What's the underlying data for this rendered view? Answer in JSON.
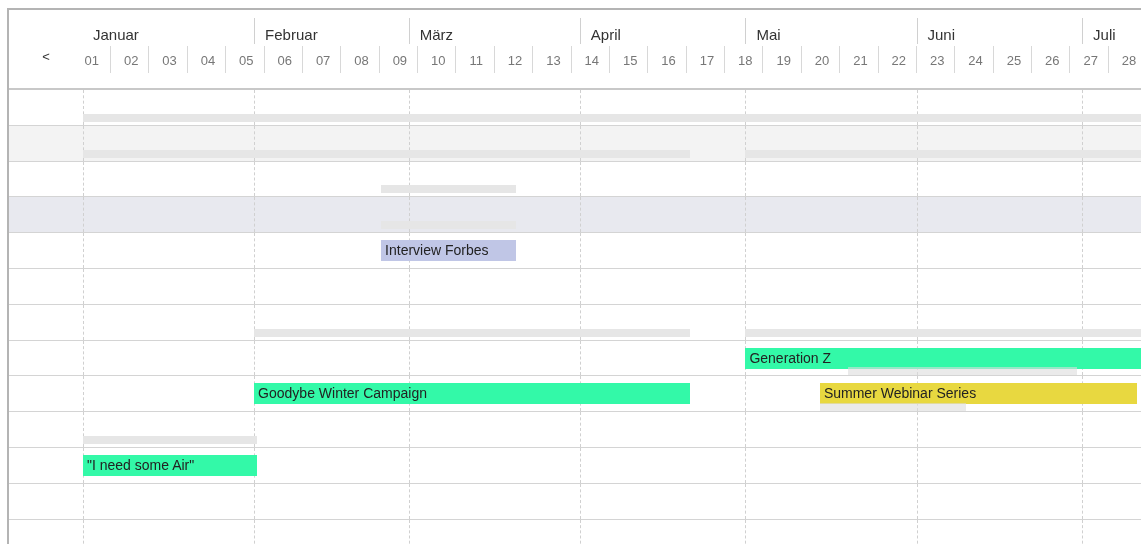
{
  "header": {
    "back_button": "<",
    "months": [
      "Januar",
      "Februar",
      "März",
      "April",
      "Mai",
      "Juni",
      "Juli"
    ],
    "weeks": [
      "01",
      "02",
      "03",
      "04",
      "05",
      "06",
      "07",
      "08",
      "09",
      "10",
      "11",
      "12",
      "13",
      "14",
      "15",
      "16",
      "17",
      "18",
      "19",
      "20",
      "21",
      "22",
      "23",
      "24",
      "25",
      "26",
      "27",
      "28"
    ]
  },
  "rows": [
    {
      "shaded": false,
      "selected": false,
      "items": [
        {
          "kind": "bracket"
        }
      ]
    },
    {
      "shaded": true,
      "selected": false,
      "items": [
        {
          "kind": "bracket"
        },
        {
          "kind": "bracket"
        }
      ]
    },
    {
      "shaded": false,
      "selected": false,
      "items": [
        {
          "kind": "bracket"
        }
      ]
    },
    {
      "shaded": false,
      "selected": true,
      "items": [
        {
          "kind": "bracket"
        }
      ]
    },
    {
      "shaded": false,
      "selected": false,
      "items": [
        {
          "kind": "bar",
          "label": "Interview Forbes",
          "color": "#c0c6e6"
        }
      ]
    },
    {
      "shaded": false,
      "selected": false,
      "items": []
    },
    {
      "shaded": false,
      "selected": false,
      "items": [
        {
          "kind": "bracket"
        },
        {
          "kind": "bracket"
        }
      ]
    },
    {
      "shaded": false,
      "selected": false,
      "items": [
        {
          "kind": "bar",
          "label": "Generation Z",
          "color": "#33f9a8"
        },
        {
          "kind": "ghost"
        }
      ]
    },
    {
      "shaded": false,
      "selected": false,
      "items": [
        {
          "kind": "bar",
          "label": "Goodybe Winter Campaign",
          "color": "#33f9a8"
        },
        {
          "kind": "bar",
          "label": "Summer Webinar Series",
          "color": "#e8d840"
        },
        {
          "kind": "ghost"
        }
      ]
    },
    {
      "shaded": false,
      "selected": false,
      "items": [
        {
          "kind": "bracket"
        }
      ]
    },
    {
      "shaded": false,
      "selected": false,
      "items": [
        {
          "kind": "bar",
          "label": "\"I need some Air\"",
          "color": "#33f9a8"
        }
      ]
    },
    {
      "shaded": false,
      "selected": false,
      "items": []
    },
    {
      "shaded": false,
      "selected": false,
      "items": []
    }
  ]
}
